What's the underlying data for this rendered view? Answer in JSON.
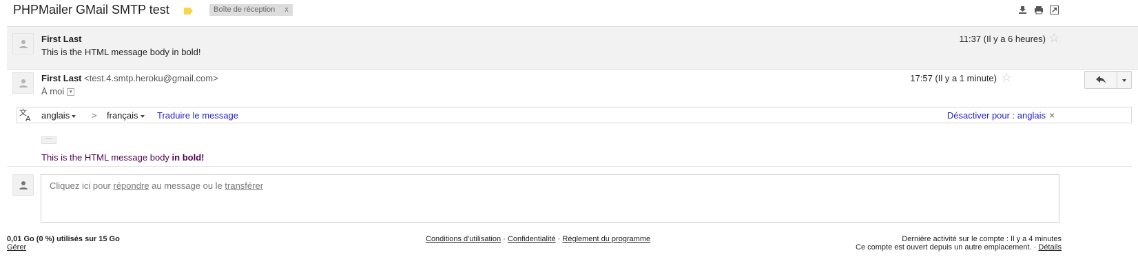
{
  "header": {
    "subject": "PHPMailer GMail SMTP test",
    "label_icon": "label-tag-icon",
    "label_color": "#f9d548",
    "inbox_badge": "Boîte de réception",
    "inbox_badge_close": "x"
  },
  "messages": [
    {
      "sender": "First Last",
      "snippet": "This is the HTML message body in bold!",
      "time": "11:37 (Il y a 6 heures)"
    },
    {
      "sender": "First Last",
      "email": "<test.4.smtp.heroku@gmail.com>",
      "to": "À moi",
      "time": "17:57 (Il y a 1 minute)",
      "body_prefix": "This is the HTML message body ",
      "body_bold": "in bold!",
      "body_color": "#500050"
    }
  ],
  "translate": {
    "from": "anglais",
    "arrow": ">",
    "to": "français",
    "action": "Traduire le message",
    "disable": "Désactiver pour : anglais",
    "close": "×"
  },
  "quoted_toggle": "···",
  "reply_box": {
    "prefix": "Cliquez ici pour ",
    "reply_link": "répondre",
    "middle": " au message ou le ",
    "forward_link": "transférer"
  },
  "footer": {
    "storage": "0,01 Go (0 %) utilisés sur 15 Go",
    "manage": "Gérer",
    "terms": "Conditions d'utilisation",
    "sep1": " · ",
    "privacy": "Confidentialité",
    "sep2": " · ",
    "program": "Règlement du programme",
    "last_activity": "Dernière activité sur le compte : Il y a 4 minutes",
    "open_elsewhere": "Ce compte est ouvert depuis un autre emplacement. · ",
    "details": "Détails"
  },
  "colors": {
    "link": "#2222cc",
    "collapsed_bg": "#f2f2f2"
  }
}
